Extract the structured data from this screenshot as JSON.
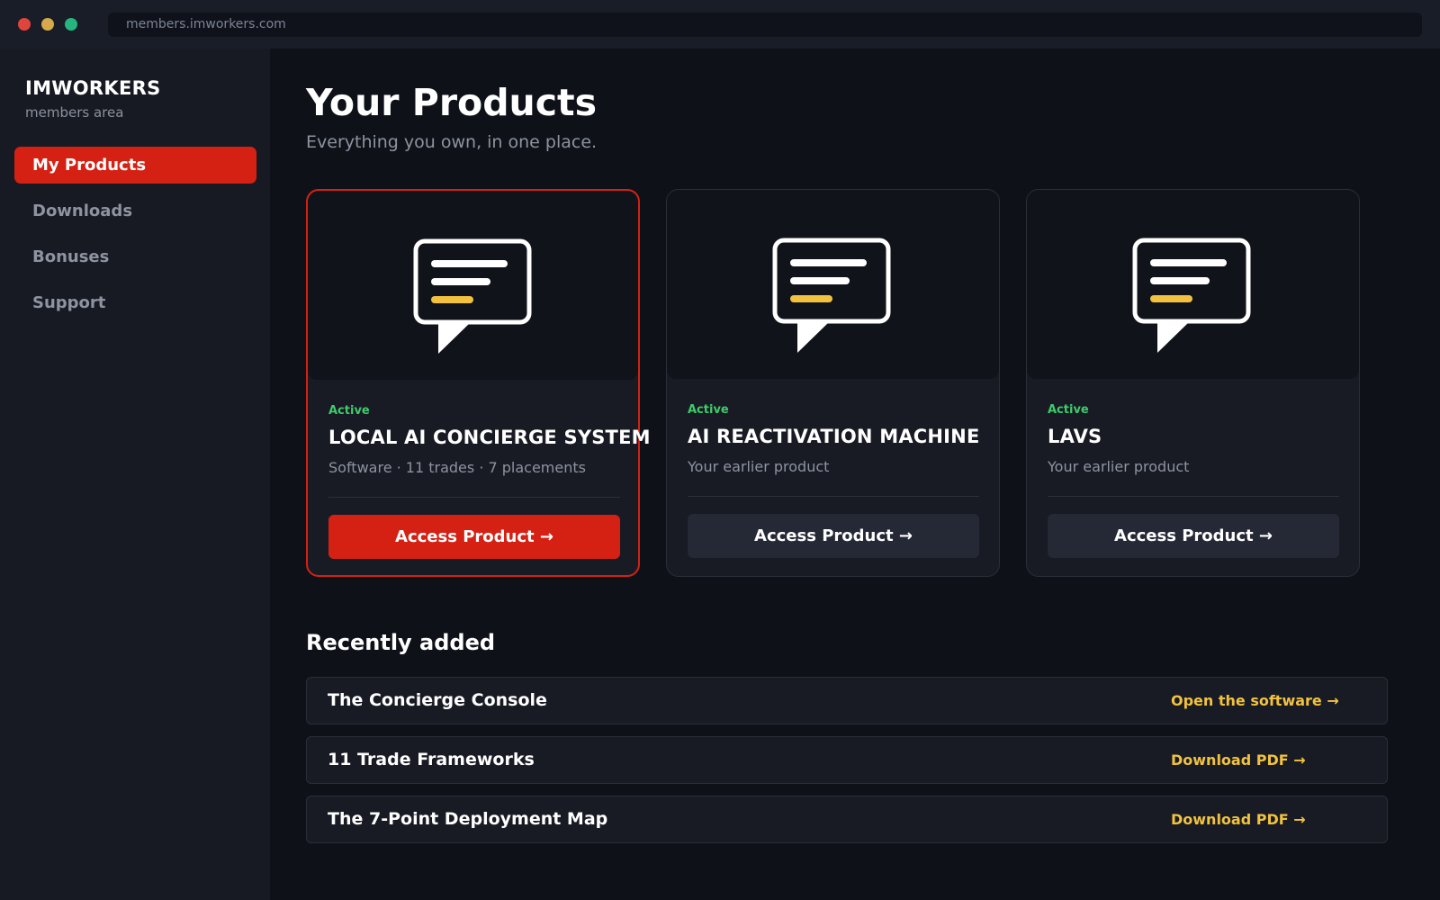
{
  "browser": {
    "url": "members.imworkers.com"
  },
  "sidebar": {
    "brand": "IMWORKERS",
    "brand_subtitle": "members area",
    "items": [
      {
        "label": "My Products",
        "active": true
      },
      {
        "label": "Downloads",
        "active": false
      },
      {
        "label": "Bonuses",
        "active": false
      },
      {
        "label": "Support",
        "active": false
      }
    ]
  },
  "main": {
    "title": "Your Products",
    "subtitle": "Everything you own, in one place.",
    "products": [
      {
        "status": "Active",
        "title": "LOCAL AI CONCIERGE SYSTEM",
        "description": "Software · 11 trades · 7 placements",
        "button": "Access Product →",
        "icon": "chat-bubble-icon"
      },
      {
        "status": "Active",
        "title": "AI REACTIVATION MACHINE",
        "description": "Your earlier product",
        "button": "Access Product →",
        "icon": "chat-bubble-icon"
      },
      {
        "status": "Active",
        "title": "LAVS",
        "description": "Your earlier product",
        "button": "Access Product →",
        "icon": "chat-bubble-icon"
      }
    ],
    "recent": {
      "title": "Recently added",
      "items": [
        {
          "title": "The Concierge Console",
          "action": "Open the software →"
        },
        {
          "title": "11 Trade Frameworks",
          "action": "Download PDF →"
        },
        {
          "title": "The 7-Point Deployment Map",
          "action": "Download PDF →"
        }
      ]
    }
  },
  "colors": {
    "accent": "#d42114",
    "highlight": "#f2c23f",
    "status_active": "#3fcb6a",
    "background": "#0e1118"
  }
}
